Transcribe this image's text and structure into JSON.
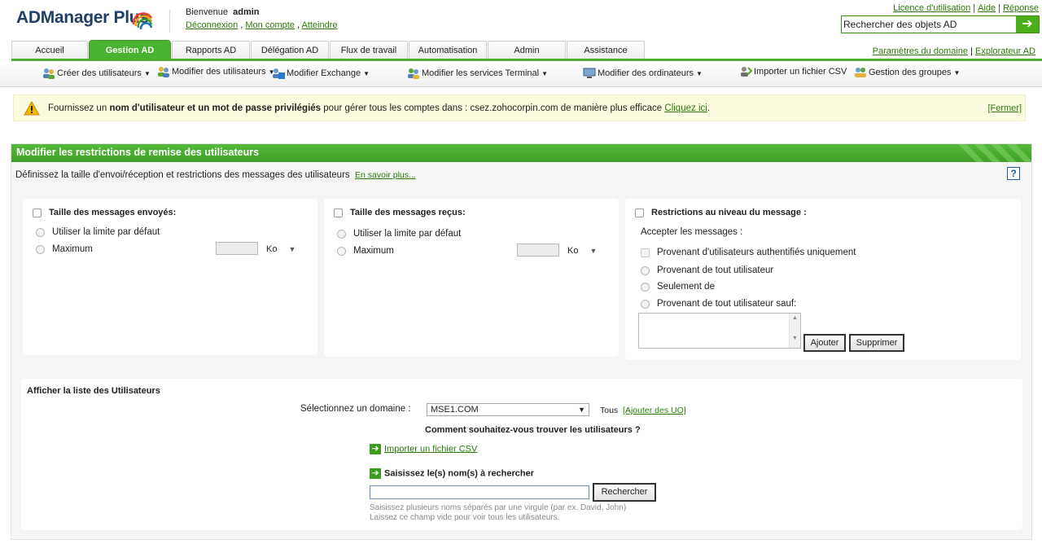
{
  "header": {
    "logo": "ADManager Plus",
    "welcome": "Bienvenue",
    "user": "admin",
    "logout": "Déconnexion",
    "my_account": "Mon compte",
    "goto": "Atteindre",
    "license": "Licence d'utilisation",
    "help": "Aide",
    "response": "Réponse",
    "search_value": "Rechercher des objets AD"
  },
  "tabs": [
    {
      "label": "Accueil"
    },
    {
      "label": "Gestion AD"
    },
    {
      "label": "Rapports AD"
    },
    {
      "label": "Délégation AD"
    },
    {
      "label": "Flux de travail"
    },
    {
      "label": "Automatisation"
    },
    {
      "label": "Admin"
    },
    {
      "label": "Assistance"
    }
  ],
  "domain_links": {
    "params": "Paramètres du domaine",
    "explorer": "Explorateur AD"
  },
  "toolbar": [
    {
      "label": "Créer des utilisateurs",
      "icon": "users-icon"
    },
    {
      "label": "Modifier des utilisateurs",
      "icon": "users-edit-icon"
    },
    {
      "label": "Modifier Exchange",
      "icon": "exchange-icon"
    },
    {
      "label": "Modifier les services Terminal",
      "icon": "terminal-users-icon"
    },
    {
      "label": "Modifier des ordinateurs",
      "icon": "computer-icon"
    },
    {
      "label": "Importer un fichier CSV",
      "icon": "import-csv-icon"
    },
    {
      "label": "Gestion des groupes",
      "icon": "groups-icon"
    }
  ],
  "warning": {
    "pre": "Fournissez un ",
    "bold": "nom d'utilisateur et un mot de passe privilégiés",
    "post": " pour gérer tous les comptes dans : csez.zohocorpin.com de manière plus efficace ",
    "link": "Cliquez ici",
    "after": ".",
    "close": "[Fermer]"
  },
  "panel": {
    "title": "Modifier les restrictions de remise des utilisateurs",
    "description": "Définissez la taille d'envoi/réception et restrictions des messages des utilisateurs",
    "learn_more": "En savoir plus..."
  },
  "sent": {
    "title": "Taille des messages envoyés:",
    "default": "Utiliser la limite par défaut",
    "max": "Maximum",
    "unit": "Ko"
  },
  "received": {
    "title": "Taille des messages reçus:",
    "default": "Utiliser la limite par défaut",
    "max": "Maximum",
    "unit": "Ko"
  },
  "restrictions": {
    "title": "Restrictions au niveau du message :",
    "accept": "Accepter les messages :",
    "auth_only": "Provenant d'utilisateurs authentifiés uniquement",
    "from_all": "Provenant de tout utilisateur",
    "only_from": "Seulement de",
    "all_except": "Provenant de tout utilisateur sauf:",
    "add": "Ajouter",
    "remove": "Supprimer"
  },
  "users": {
    "title": "Afficher la liste des Utilisateurs",
    "select_domain": "Sélectionnez un domaine :",
    "domain": "MSE1.COM",
    "all": "Tous",
    "add_ou": "[Ajouter des UO]",
    "how": "Comment souhaitez-vous trouver les utilisateurs ?",
    "import_csv": "Importer un fichier CSV",
    "enter_names": "Saisissez le(s) nom(s) à rechercher",
    "search_btn": "Rechercher",
    "hint1": "Saisissez plusieurs noms séparés par une virgule (par ex. David, John)",
    "hint2": "Laissez ce champ vide pour voir tous les utilisateurs."
  }
}
